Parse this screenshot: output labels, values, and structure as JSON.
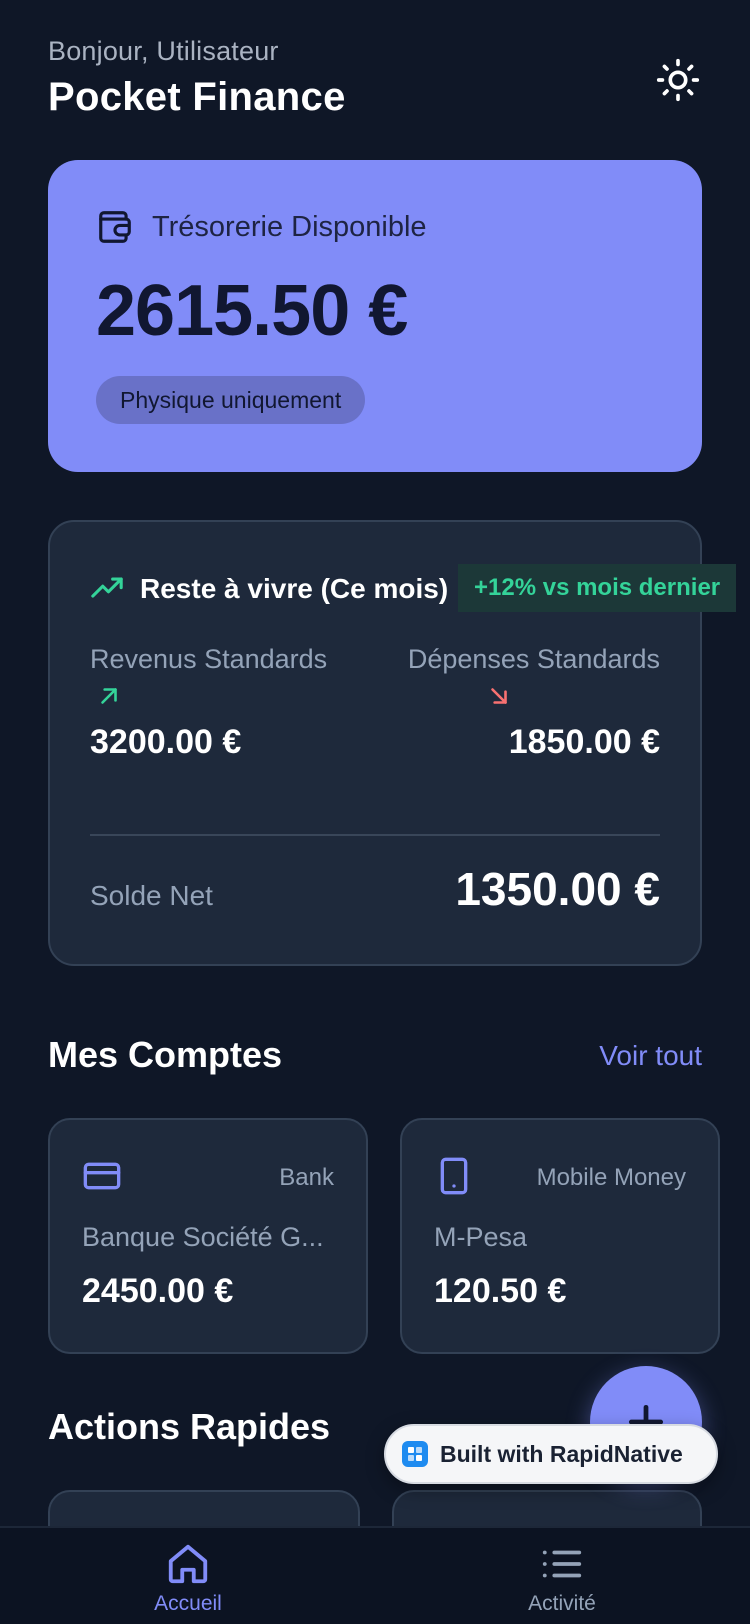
{
  "header": {
    "greeting": "Bonjour, Utilisateur",
    "title": "Pocket Finance",
    "theme_icon": "sun-icon"
  },
  "balance": {
    "label": "Trésorerie Disponible",
    "amount": "2615.50 €",
    "badge": "Physique uniquement",
    "icon": "wallet-icon",
    "color": "#818cf8"
  },
  "summary": {
    "title": "Reste à vivre (Ce mois)",
    "trend_badge": "+12% vs mois dernier",
    "income_label": "Revenus Standards",
    "income_value": "3200.00 €",
    "expense_label": "Dépenses Standards",
    "expense_value": "1850.00 €",
    "net_label": "Solde Net",
    "net_value": "1350.00 €",
    "positive_color": "#34d399",
    "negative_color": "#f87171"
  },
  "accounts": {
    "title": "Mes Comptes",
    "see_all": "Voir tout",
    "items": [
      {
        "type": "Bank",
        "name": "Banque Société G...",
        "amount": "2450.00 €",
        "icon": "credit-card-icon"
      },
      {
        "type": "Mobile Money",
        "name": "M-Pesa",
        "amount": "120.50 €",
        "icon": "smartphone-icon"
      }
    ]
  },
  "quick_actions": {
    "title": "Actions Rapides"
  },
  "built_with": {
    "label": "Built with RapidNative"
  },
  "tabbar": {
    "items": [
      {
        "label": "Accueil",
        "icon": "home-icon",
        "active": true
      },
      {
        "label": "Activité",
        "icon": "list-icon",
        "active": false
      }
    ]
  }
}
